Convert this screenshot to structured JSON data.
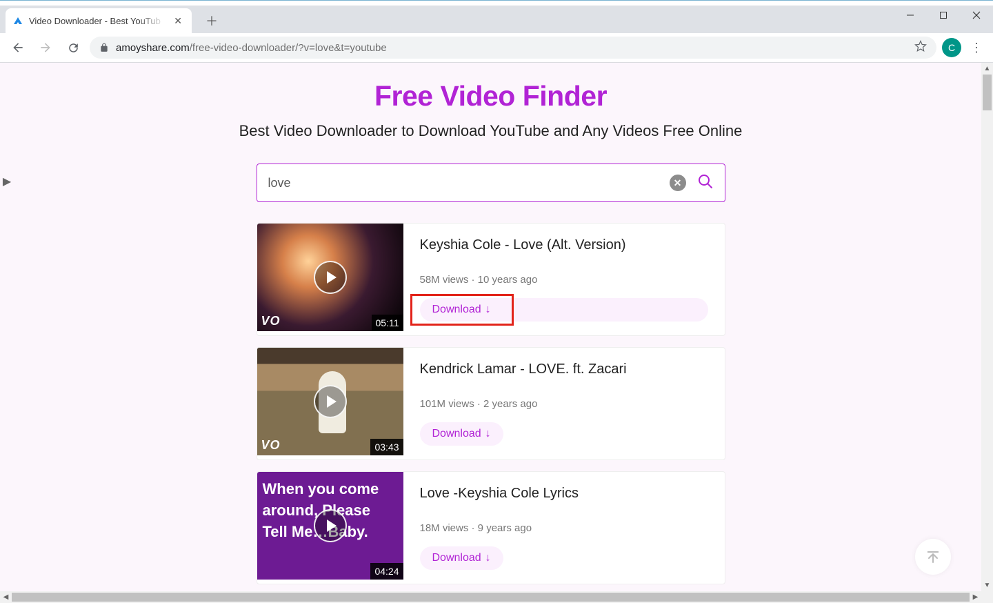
{
  "window": {
    "tab_title": "Video Downloader - Best YouTub"
  },
  "avatar": {
    "letter": "C"
  },
  "omnibox": {
    "host": "amoyshare.com",
    "path": "/free-video-downloader/?v=love&t=youtube"
  },
  "page": {
    "heading": "Free Video Finder",
    "subheading": "Best Video Downloader to Download YouTube and Any Videos Free Online"
  },
  "search": {
    "value": "love"
  },
  "download_label": "Download",
  "vevo_label": "VO",
  "results": [
    {
      "title": "Keyshia Cole - Love (Alt. Version)",
      "meta": "58M views · 10 years ago",
      "duration": "05:11",
      "vevo": true,
      "highlight": true
    },
    {
      "title": "Kendrick Lamar - LOVE. ft. Zacari",
      "meta": "101M views · 2 years ago",
      "duration": "03:43",
      "vevo": true,
      "highlight": false
    },
    {
      "title": "Love -Keyshia Cole Lyrics",
      "meta": "18M views · 9 years ago",
      "duration": "04:24",
      "vevo": false,
      "highlight": false,
      "overlay_text": "When you come around, Please Tell Me…Baby."
    }
  ]
}
